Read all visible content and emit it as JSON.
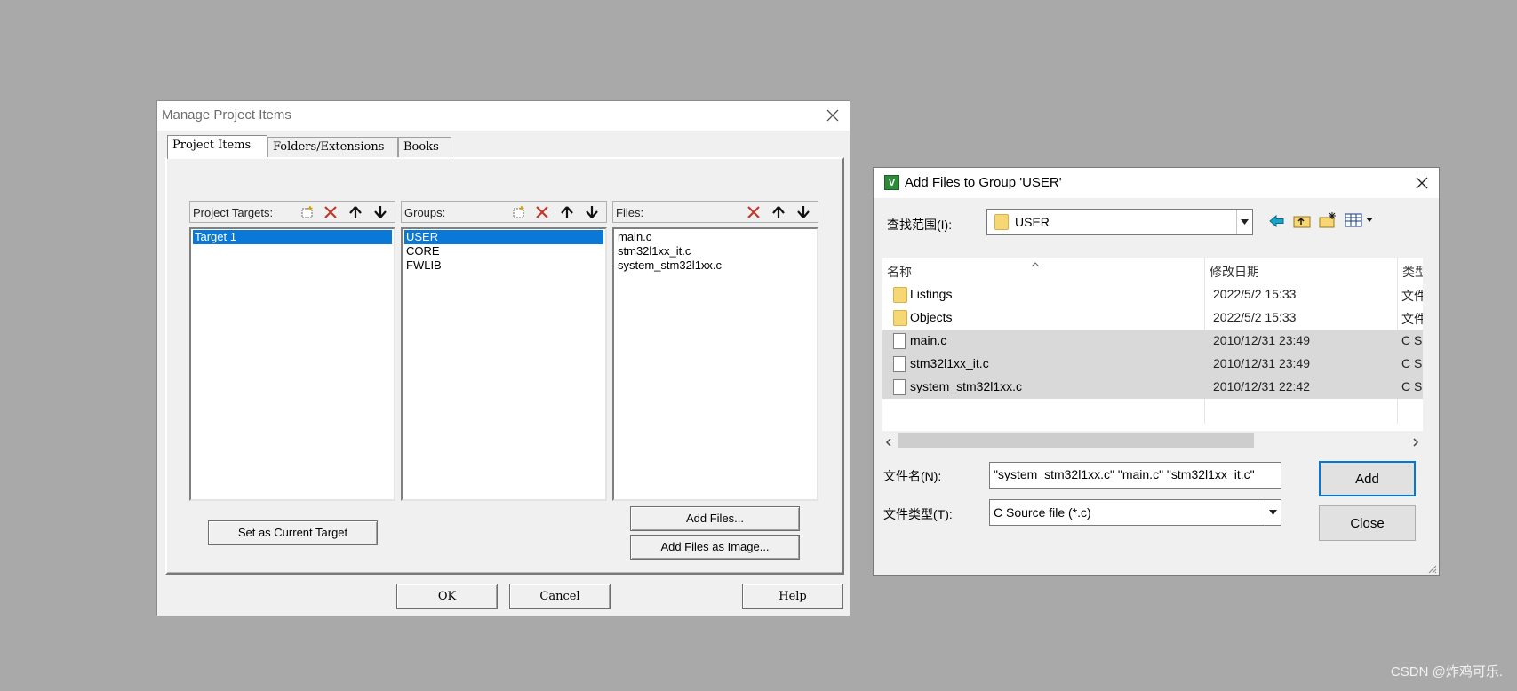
{
  "manage_dialog": {
    "title": "Manage Project Items",
    "tabs": [
      {
        "label": "Project Items",
        "active": true
      },
      {
        "label": "Folders/Extensions",
        "active": false
      },
      {
        "label": "Books",
        "active": false
      }
    ],
    "targets": {
      "header": "Project Targets:",
      "items": [
        {
          "label": "Target 1",
          "selected": true
        }
      ]
    },
    "groups": {
      "header": "Groups:",
      "items": [
        {
          "label": "USER",
          "selected": true
        },
        {
          "label": "CORE",
          "selected": false
        },
        {
          "label": "FWLIB",
          "selected": false
        }
      ]
    },
    "files": {
      "header": "Files:",
      "items": [
        {
          "label": "main.c"
        },
        {
          "label": "stm32l1xx_it.c"
        },
        {
          "label": "system_stm32l1xx.c"
        }
      ]
    },
    "buttons": {
      "set_current": "Set as Current Target",
      "add_files": "Add Files...",
      "add_files_image": "Add Files as Image...",
      "ok": "OK",
      "cancel": "Cancel",
      "help": "Help"
    }
  },
  "add_dialog": {
    "title": "Add Files to Group 'USER'",
    "app_icon_letter": "V",
    "look_in_label": "查找范围(I):",
    "look_in_value": "USER",
    "columns": {
      "name": "名称",
      "date": "修改日期",
      "type": "类型"
    },
    "rows": [
      {
        "name": "Listings",
        "date": "2022/5/2 15:33",
        "type": "文件夹",
        "kind": "folder",
        "selected": false
      },
      {
        "name": "Objects",
        "date": "2022/5/2 15:33",
        "type": "文件夹",
        "kind": "folder",
        "selected": false
      },
      {
        "name": "main.c",
        "date": "2010/12/31 23:49",
        "type": "C Source file",
        "kind": "file",
        "selected": true
      },
      {
        "name": "stm32l1xx_it.c",
        "date": "2010/12/31 23:49",
        "type": "C Source file",
        "kind": "file",
        "selected": true
      },
      {
        "name": "system_stm32l1xx.c",
        "date": "2010/12/31 22:42",
        "type": "C Source file",
        "kind": "file",
        "selected": true
      }
    ],
    "filename_label": "文件名(N):",
    "filename_value": "\"system_stm32l1xx.c\" \"main.c\" \"stm32l1xx_it.c\"",
    "filetype_label": "文件类型(T):",
    "filetype_value": "C Source file (*.c)",
    "buttons": {
      "add": "Add",
      "close": "Close"
    }
  },
  "watermark": "CSDN @炸鸡可乐.",
  "colors": {
    "desktop": "#a9a9a9",
    "selection_blue": "#0a78d7",
    "selected_row_gray": "#d9d9d9",
    "delete_red": "#c0392b",
    "nav_cyan": "#1aa3c9"
  }
}
